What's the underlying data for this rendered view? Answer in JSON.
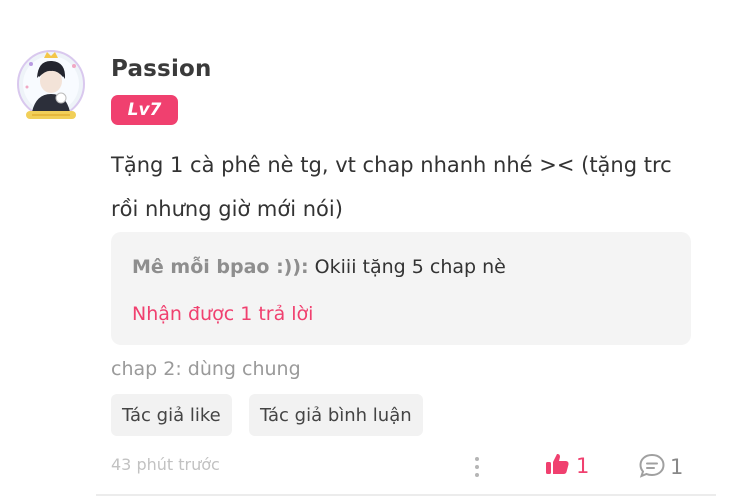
{
  "comment": {
    "username": "Passion",
    "level": "Lv7",
    "text": "Tặng 1 cà phê nè tg, vt chap nhanh nhé >< (tặng trc rồi nhưng giờ mới nói)",
    "chapter_info": "chap 2: dùng chung",
    "tags": [
      "Tác giả like",
      "Tác giả bình luận"
    ],
    "timestamp": "43 phút trước",
    "like_count": "1",
    "reply_count": "1"
  },
  "reply_preview": {
    "author": "Mê mỗi bpao :)):",
    "text": " Okiii tặng 5 chap nè",
    "count_label": "Nhận được 1 trả lời"
  },
  "colors": {
    "accent": "#f0406f",
    "muted": "#9a9a9a",
    "reply_bg": "#f4f4f4"
  },
  "icons": {
    "more": "more-vertical-icon",
    "like": "thumbs-up-icon",
    "reply": "speech-bubble-icon"
  }
}
